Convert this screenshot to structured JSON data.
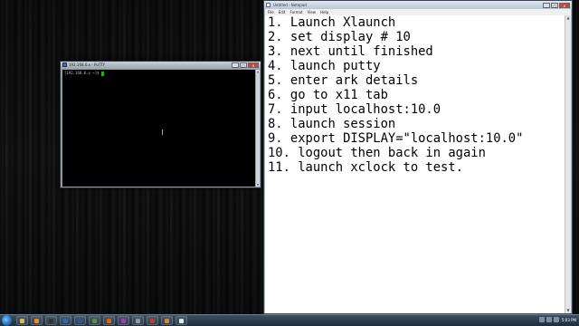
{
  "putty": {
    "title": "192.168.0.x - PuTTY",
    "prompt": "[192.168.0.x ~]$ ",
    "buttons": {
      "minimize": "_",
      "maximize": "□",
      "close": "x"
    }
  },
  "notepad": {
    "title": "Untitled - Notepad",
    "menu": [
      "File",
      "Edit",
      "Format",
      "View",
      "Help"
    ],
    "buttons": {
      "minimize": "_",
      "maximize": "□",
      "close": "x"
    },
    "lines": [
      "1. Launch Xlaunch",
      "2. set display # 10",
      "3. next until finished",
      "4. launch putty",
      "5. enter ark details",
      "6. go to x11 tab",
      "7. input localhost:10.0",
      "8. launch session",
      "9. export DISPLAY=\"localhost:10.0\"",
      "10. logout then back in again",
      "11. launch xclock to test."
    ]
  },
  "taskbar": {
    "clock": "5:03 PM",
    "tasks": [
      {
        "icon": "folder-icon",
        "color": "#e2b84a"
      },
      {
        "icon": "media-player-icon",
        "color": "#f08a1c"
      },
      {
        "icon": "terminal-icon",
        "color": "#333333"
      },
      {
        "icon": "app-icon",
        "color": "#2a66b8"
      },
      {
        "icon": "word-icon",
        "color": "#2b579a"
      },
      {
        "icon": "app-icon",
        "color": "#5a8f3c"
      },
      {
        "icon": "firefox-icon",
        "color": "#e66000"
      },
      {
        "icon": "app-icon",
        "color": "#9a3cb8"
      },
      {
        "icon": "putty-icon",
        "color": "#8a9aa8"
      },
      {
        "icon": "app-icon",
        "color": "#c0392b"
      },
      {
        "icon": "app-icon",
        "color": "#d08b2c"
      },
      {
        "icon": "notepad-icon",
        "color": "#dfe8f2"
      }
    ]
  }
}
